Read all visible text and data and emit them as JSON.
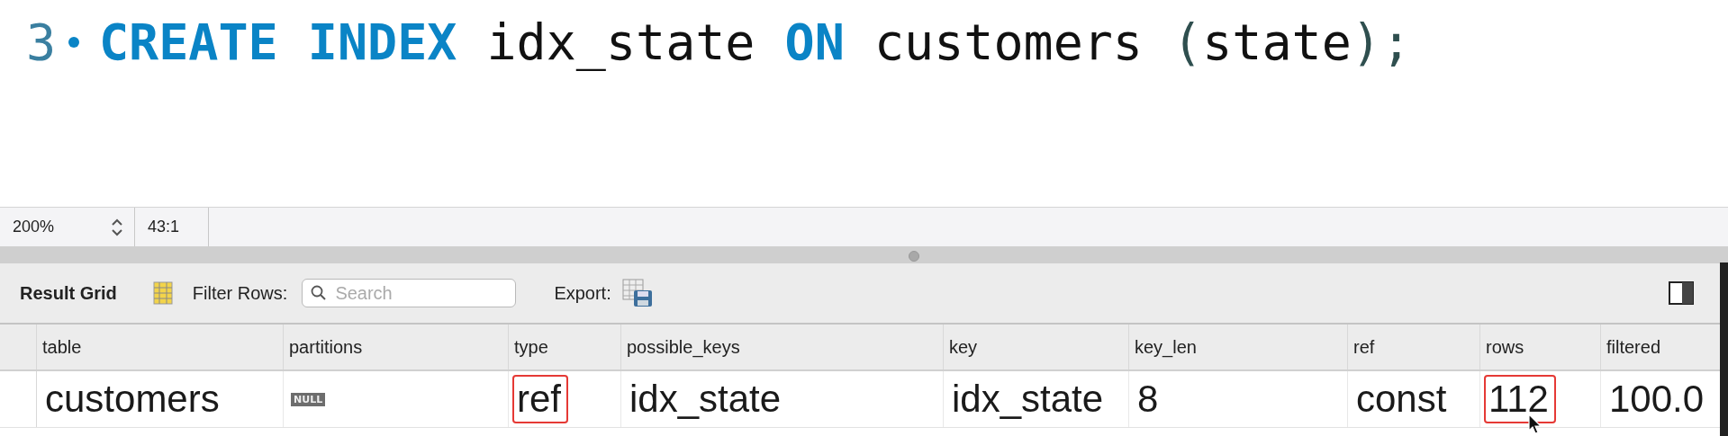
{
  "editor": {
    "lines": [
      {
        "number": "3",
        "tokens": [
          {
            "kind": "keyword",
            "text": "CREATE INDEX"
          },
          {
            "kind": "ident",
            "text": " idx_state "
          },
          {
            "kind": "keyword",
            "text": "ON"
          },
          {
            "kind": "ident",
            "text": " customers "
          },
          {
            "kind": "punct",
            "text": "("
          },
          {
            "kind": "ident",
            "text": "state"
          },
          {
            "kind": "punct",
            "text": ");"
          }
        ]
      }
    ]
  },
  "status_bar": {
    "zoom": "200%",
    "position": "43:1"
  },
  "result_toolbar": {
    "title": "Result Grid",
    "filter_label": "Filter Rows:",
    "search": {
      "placeholder": "Search"
    },
    "export_label": "Export:"
  },
  "table": {
    "columns": [
      "table",
      "partitions",
      "type",
      "possible_keys",
      "key",
      "key_len",
      "ref",
      "rows",
      "filtered"
    ],
    "rows": [
      {
        "cells": [
          {
            "kind": "text",
            "text": "customers",
            "highlighted": false
          },
          {
            "kind": "null",
            "text": "NULL",
            "highlighted": false
          },
          {
            "kind": "text",
            "text": "ref",
            "highlighted": true
          },
          {
            "kind": "text",
            "text": "idx_state",
            "highlighted": false
          },
          {
            "kind": "text",
            "text": "idx_state",
            "highlighted": false
          },
          {
            "kind": "text",
            "text": "8",
            "highlighted": false
          },
          {
            "kind": "text",
            "text": "const",
            "highlighted": false
          },
          {
            "kind": "text",
            "text": "112",
            "highlighted": true
          },
          {
            "kind": "text",
            "text": "100.0",
            "highlighted": false
          }
        ]
      }
    ]
  }
}
